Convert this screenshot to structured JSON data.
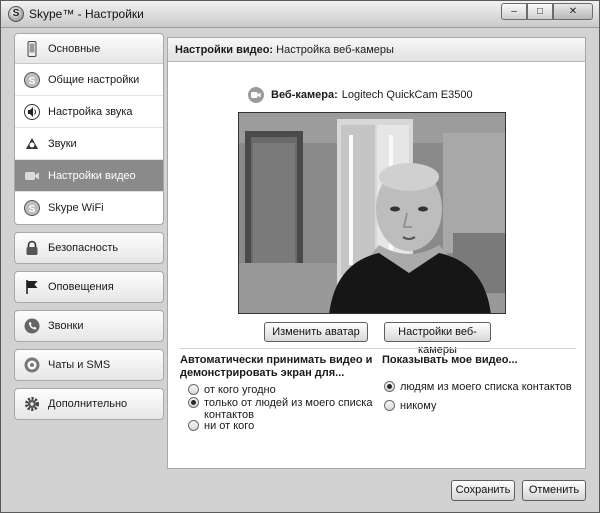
{
  "window": {
    "title": "Skype™ - Настройки",
    "controls": {
      "minimize": "–",
      "maximize": "□",
      "close": "✕"
    }
  },
  "nav": {
    "main_group": "Основные",
    "sub_items": [
      {
        "label": "Общие настройки",
        "icon": "skype-icon"
      },
      {
        "label": "Настройка звука",
        "icon": "speaker-icon"
      },
      {
        "label": "Звуки",
        "icon": "music-note-icon"
      },
      {
        "label": "Настройки видео",
        "icon": "video-camera-icon",
        "active": true
      },
      {
        "label": "Skype WiFi",
        "icon": "skype-icon"
      }
    ],
    "groups": [
      {
        "label": "Безопасность",
        "icon": "lock-icon"
      },
      {
        "label": "Оповещения",
        "icon": "flag-icon"
      },
      {
        "label": "Звонки",
        "icon": "phone-icon"
      },
      {
        "label": "Чаты и SMS",
        "icon": "chat-icon"
      },
      {
        "label": "Дополнительно",
        "icon": "gear-icon"
      }
    ]
  },
  "main": {
    "header_bold": "Настройки видео:",
    "header_rest": " Настройка веб-камеры",
    "webcam_label": "Веб-камера:",
    "webcam_name": "Logitech QuickCam E3500",
    "change_avatar": "Изменить аватар",
    "webcam_settings": "Настройки веб-камеры",
    "auto_accept": {
      "title_line1": "Автоматически принимать видео и",
      "title_line2": "демонстрировать экран для...",
      "options": [
        {
          "label": "от кого угодно",
          "checked": false
        },
        {
          "label_line1": "только от людей из моего списка",
          "label_line2": "контактов",
          "checked": true
        },
        {
          "label": "ни от кого",
          "checked": false
        }
      ]
    },
    "show_video": {
      "title": "Показывать мое видео...",
      "options": [
        {
          "label": "людям из моего списка контактов",
          "checked": true
        },
        {
          "label": "никому",
          "checked": false
        }
      ]
    }
  },
  "footer": {
    "save": "Сохранить",
    "cancel": "Отменить"
  }
}
